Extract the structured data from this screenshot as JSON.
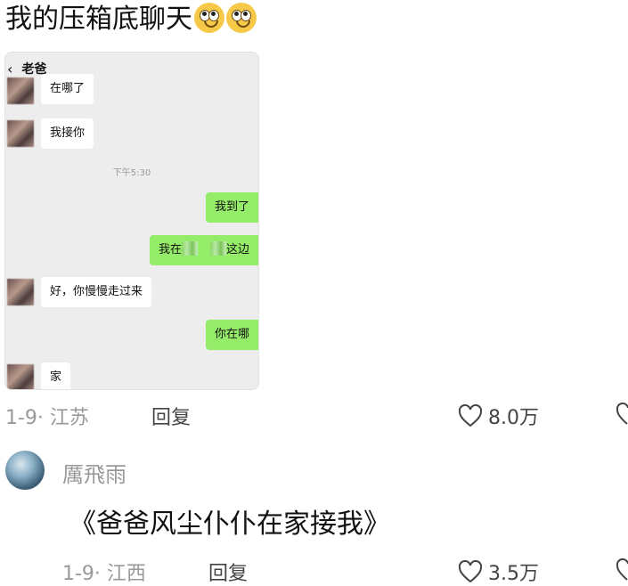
{
  "comment1": {
    "text": "我的压箱底聊天",
    "emojis": [
      "crying-face-icon",
      "crying-face-icon"
    ],
    "date_location": "1-9· 江苏",
    "reply_label": "回复",
    "likes": "8.0万"
  },
  "chat_screenshot": {
    "header_title": "老爸",
    "timestamp": "下午5:30",
    "messages": [
      {
        "side": "in",
        "text": "在哪了"
      },
      {
        "side": "in",
        "text": "我接你"
      },
      {
        "side": "out",
        "text": "我到了"
      },
      {
        "side": "out",
        "text_before": "我在",
        "text_after": "这边"
      },
      {
        "side": "in",
        "text": "好，你慢慢走过来"
      },
      {
        "side": "out",
        "text": "你在哪"
      },
      {
        "side": "in",
        "text": "家"
      }
    ]
  },
  "comment2": {
    "username": "厲飛雨",
    "text": "《爸爸风尘仆仆在家接我》",
    "date_location": "1-9· 江西",
    "reply_label": "回复",
    "likes": "3.5万"
  },
  "colors": {
    "outgoing_bubble": "#95ec69",
    "meta_gray": "#999999"
  }
}
